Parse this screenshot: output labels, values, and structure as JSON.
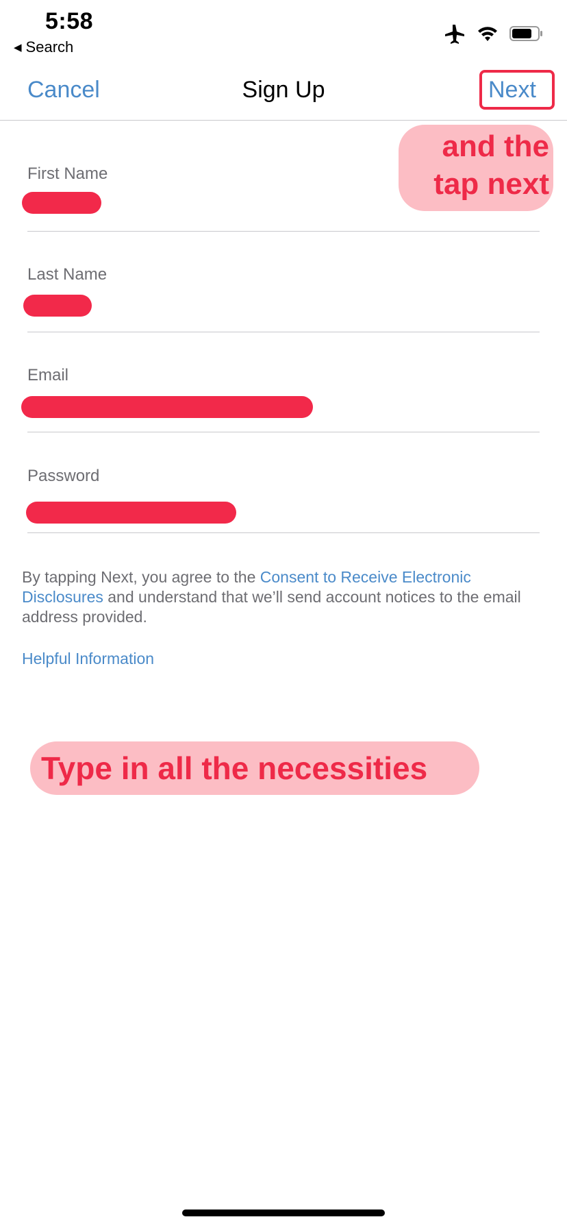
{
  "status_bar": {
    "time": "5:58",
    "back_label": "Search",
    "icons": [
      "airplane-icon",
      "wifi-icon",
      "battery-icon"
    ]
  },
  "nav": {
    "cancel_label": "Cancel",
    "title": "Sign Up",
    "next_label": "Next"
  },
  "form": {
    "fields": [
      {
        "label": "First Name",
        "value_redacted": true
      },
      {
        "label": "Last Name",
        "value_redacted": true
      },
      {
        "label": "Email",
        "value_redacted": true
      },
      {
        "label": "Password",
        "value_redacted": true
      }
    ]
  },
  "disclaimer": {
    "prefix": "By tapping Next, you agree to the ",
    "link": "Consent to Receive Electronic Disclosures",
    "suffix": " and understand that we’ll send account notices to the email address provided."
  },
  "helpful_link": "Helpful Information",
  "annotations": {
    "top_right": "and the\ntap next",
    "bottom": "Type in all the necessities"
  },
  "colors": {
    "accent": "#4a8ac9",
    "annotation": "#ee2a48",
    "annotation_bg": "#fcbdc4"
  }
}
